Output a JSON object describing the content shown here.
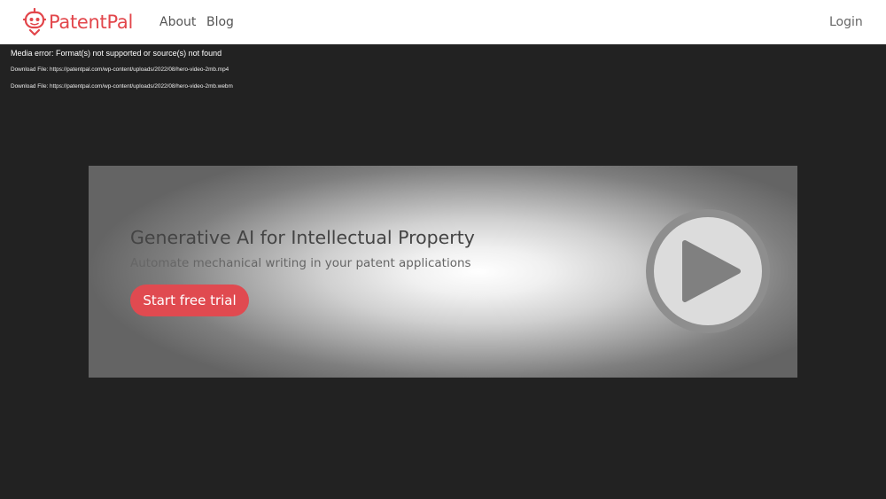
{
  "header": {
    "logo_text": "PatentPal",
    "nav": {
      "about": "About",
      "blog": "Blog",
      "login": "Login"
    }
  },
  "media_fallback": {
    "error": "Media error: Format(s) not supported or source(s) not found",
    "downloads": [
      "Download File: https://patentpal.com/wp-content/uploads/2022/08/hero-video-2mb.mp4",
      "Download File: https://patentpal.com/wp-content/uploads/2022/08/hero-video-2mb.webm"
    ]
  },
  "hero": {
    "title": "Generative AI for Intellectual Property",
    "subtitle": "Automate mechanical writing in your patent applications",
    "cta": "Start free trial",
    "play_icon": "play-icon"
  },
  "colors": {
    "brand": "#e2464b",
    "cta": "#e04a50",
    "page_background": "#222222",
    "header_background": "#ffffff"
  }
}
